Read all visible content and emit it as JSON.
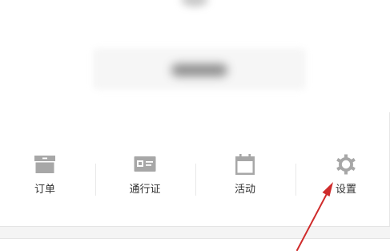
{
  "nav": {
    "items": [
      {
        "label": "订单",
        "icon": "order-box-icon"
      },
      {
        "label": "通行证",
        "icon": "pass-card-icon"
      },
      {
        "label": "活动",
        "icon": "calendar-icon"
      },
      {
        "label": "设置",
        "icon": "gear-icon"
      }
    ]
  },
  "colors": {
    "icon_gray": "#a7a7a7",
    "label_text": "#333333",
    "annotation_arrow": "#cf2b2b"
  }
}
